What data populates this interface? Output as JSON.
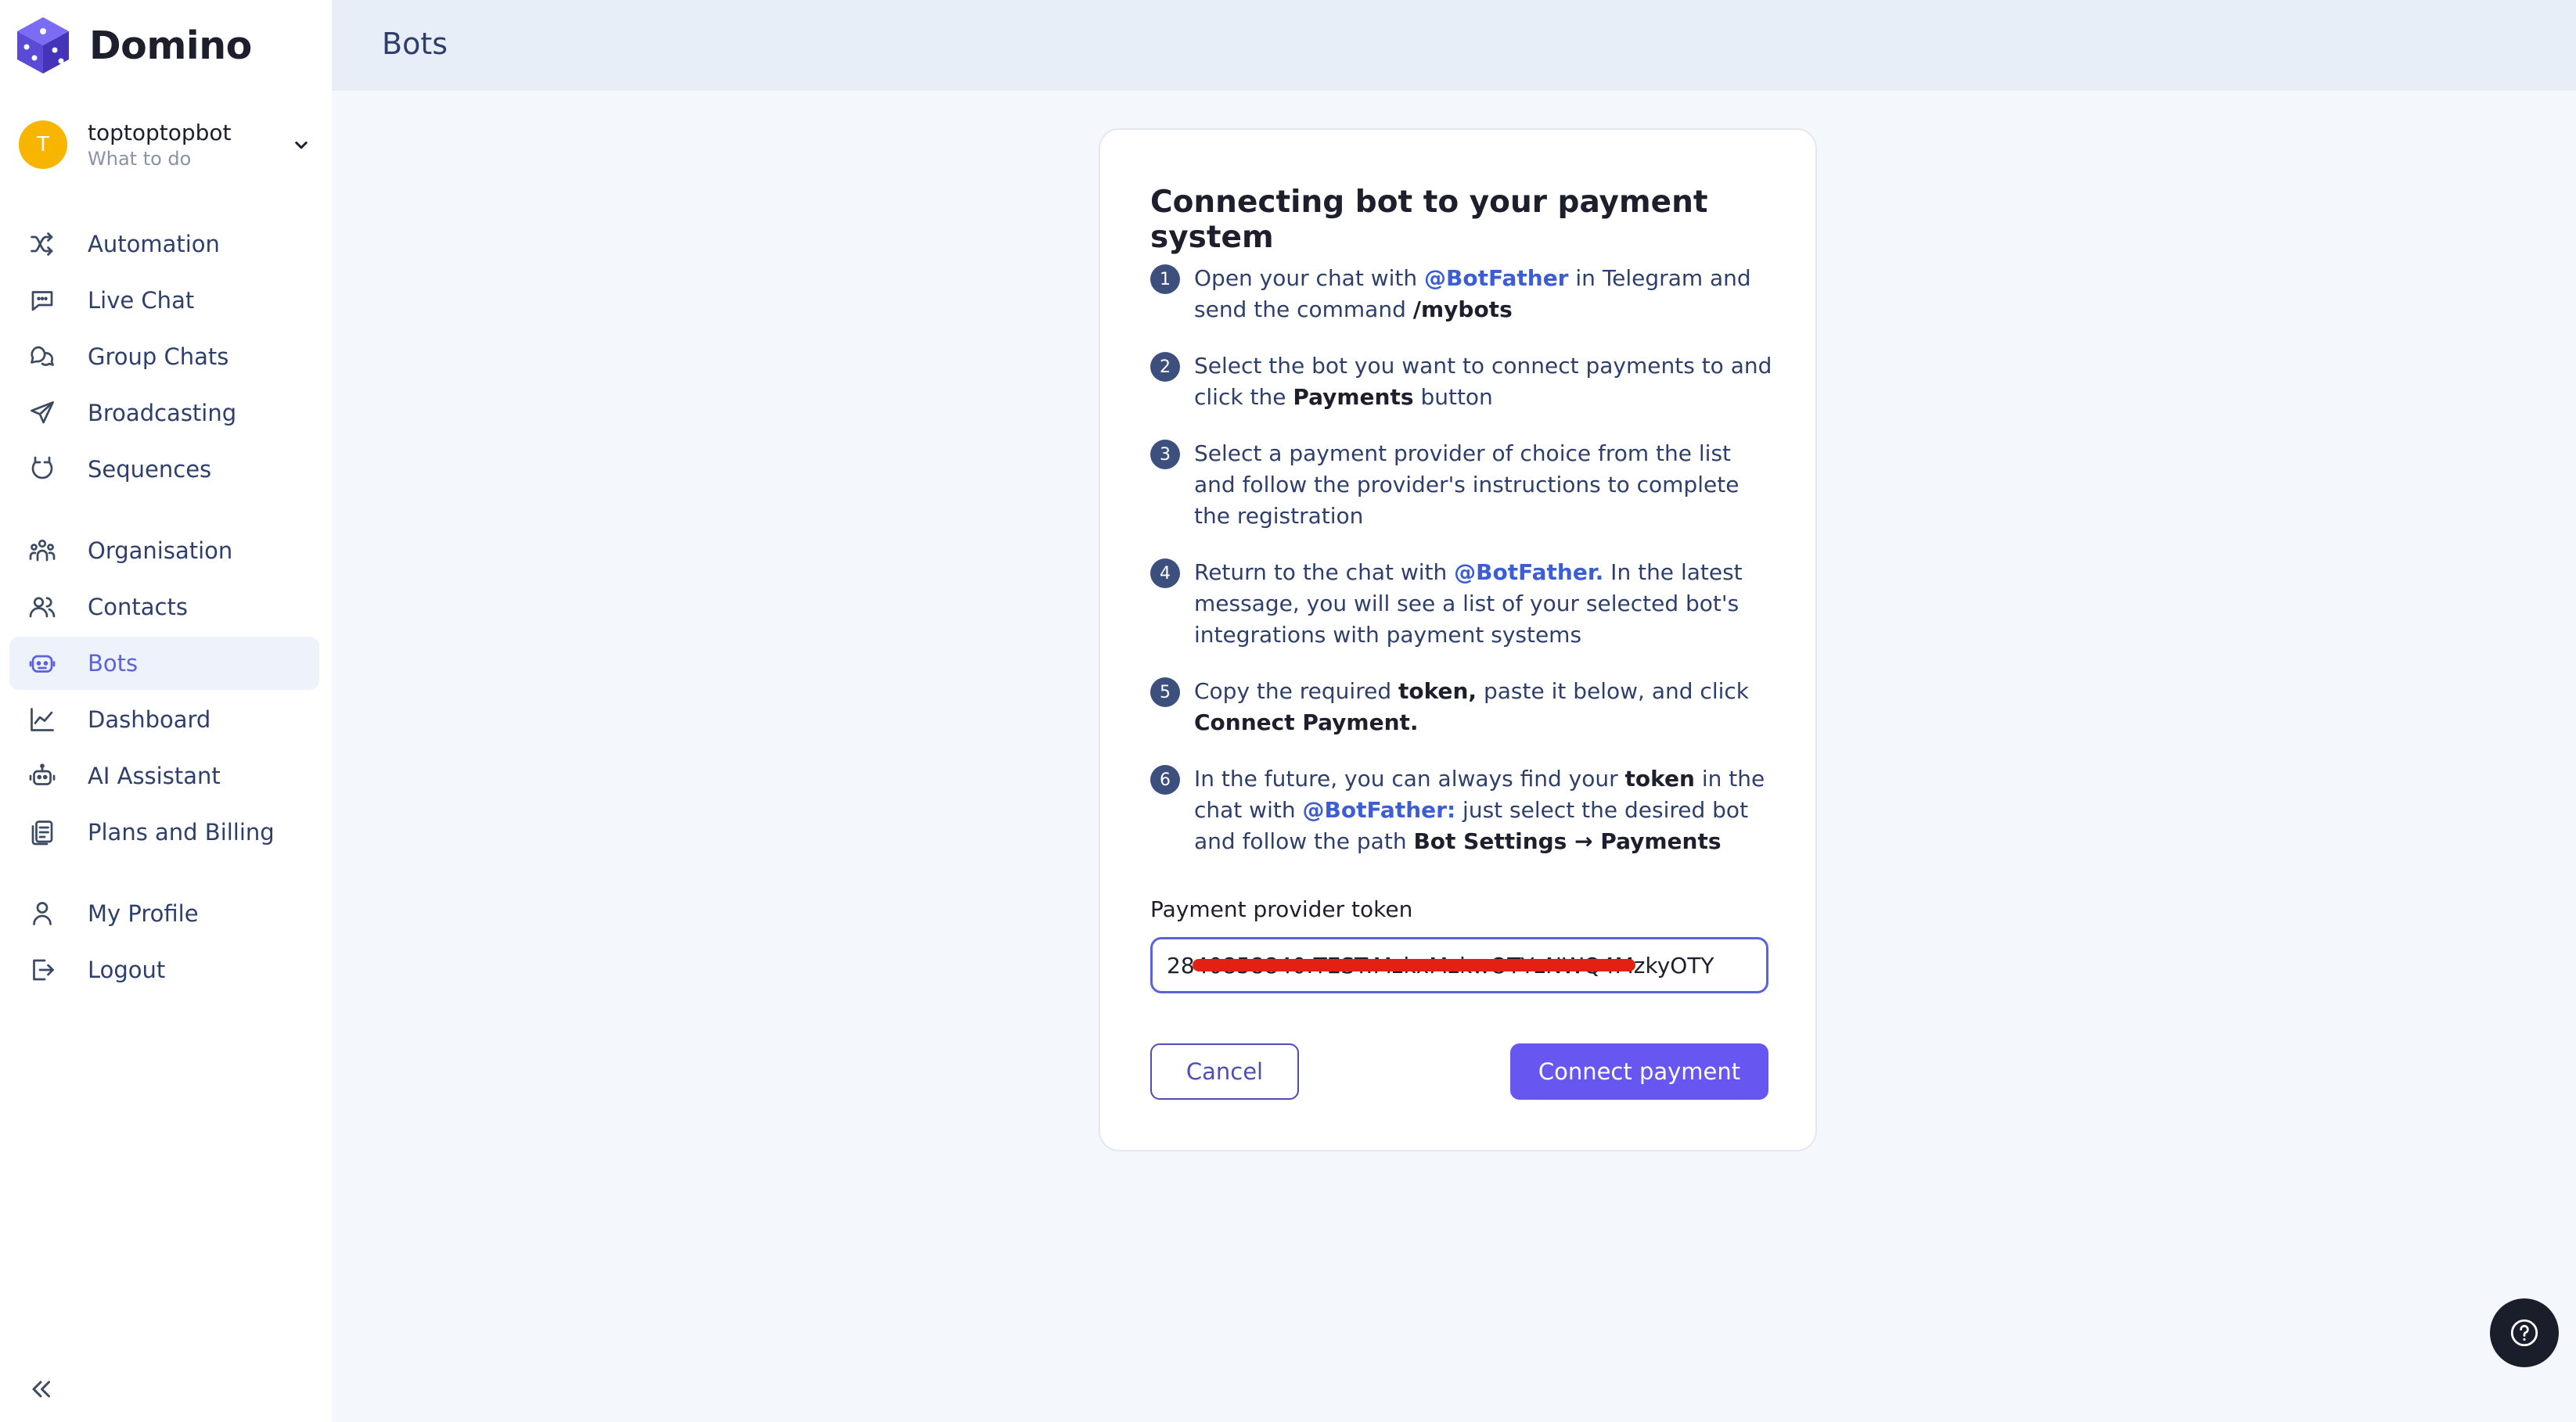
{
  "app": {
    "name": "Domino"
  },
  "account": {
    "initial": "T",
    "name": "toptoptopbot",
    "subtitle": "What to do"
  },
  "sidebar": {
    "items": [
      {
        "label": "Automation",
        "icon": "shuffle-icon"
      },
      {
        "label": "Live Chat",
        "icon": "chat-bubble-icon"
      },
      {
        "label": "Group Chats",
        "icon": "group-chat-icon"
      },
      {
        "label": "Broadcasting",
        "icon": "paper-plane-icon"
      },
      {
        "label": "Sequences",
        "icon": "sequence-icon"
      },
      {
        "label": "Organisation",
        "icon": "organisation-icon"
      },
      {
        "label": "Contacts",
        "icon": "contacts-icon"
      },
      {
        "label": "Bots",
        "icon": "bot-icon",
        "active": true
      },
      {
        "label": "Dashboard",
        "icon": "chart-line-icon"
      },
      {
        "label": "AI Assistant",
        "icon": "robot-icon"
      },
      {
        "label": "Plans and Billing",
        "icon": "billing-icon"
      },
      {
        "label": "My Profile",
        "icon": "user-icon"
      },
      {
        "label": "Logout",
        "icon": "logout-icon"
      }
    ]
  },
  "header": {
    "title": "Bots"
  },
  "dialog": {
    "title": "Connecting bot to your payment system",
    "steps": [
      {
        "num": "1",
        "t1": "Open your chat with ",
        "link": "@BotFather",
        "t2": " in Telegram and send the command ",
        "bold": "/mybots"
      },
      {
        "num": "2",
        "t1": "Select the bot you want to connect payments to and click the ",
        "bold": "Payments",
        "t2": " button"
      },
      {
        "num": "3",
        "t1": "Select a payment provider of choice from the list and follow the provider's instructions to complete the registration"
      },
      {
        "num": "4",
        "t1": "Return to the chat with ",
        "link": "@BotFather.",
        "t2": " In the latest message, you will see a list of your selected bot's integrations with payment systems"
      },
      {
        "num": "5",
        "t1": "Copy the required ",
        "bold": "token,",
        "t2": " paste it below, and click ",
        "bold2": "Connect Payment."
      },
      {
        "num": "6",
        "t1": "In the future, you can always find your ",
        "bold": "token",
        "t2": " in the chat with ",
        "link": "@BotFather:",
        "t3": " just select the desired bot and follow the path ",
        "bold2": "Bot Settings → Payments"
      }
    ],
    "field_label": "Payment provider token",
    "token_value": "2840858840:TEST:MzkxMzkwOTYzNWQ4MzkyOTY",
    "cancel_label": "Cancel",
    "connect_label": "Connect payment"
  },
  "help": {
    "icon": "question-icon"
  }
}
